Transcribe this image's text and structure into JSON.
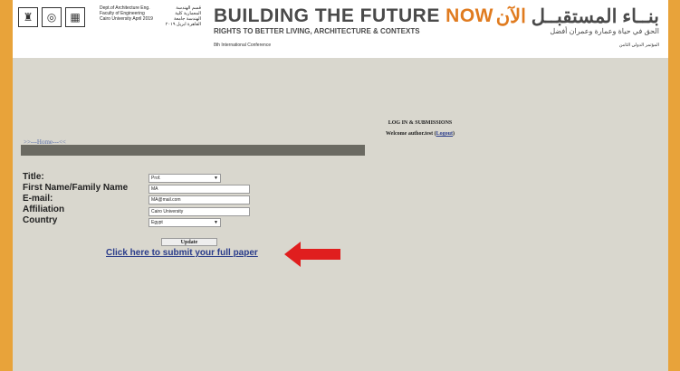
{
  "banner": {
    "dept_en": "Dept.of Architecture Eng. Faculty of Engineering Cairo University April 2019",
    "dept_ar": "قسم الهندسة المعمارية كلية الهندسة جامعة القاهرة ابريل ٢٠١٩",
    "title_main": "BUILDING THE FUTURE ",
    "title_now": "NOW",
    "subtitle": "RIGHTS TO BETTER LIVING, ARCHITECTURE & CONTEXTS",
    "conference_en": "8th International Conference",
    "title_ar_main": "بنــاء المستقبــل ",
    "title_ar_now": "الآن",
    "subtitle_ar": "الحق في حياة وعمارة وعمران أفضل",
    "conference_ar": "المؤتمر الدولي الثامن"
  },
  "nav": {
    "home_link": ">>---Home---<<"
  },
  "login": {
    "header": "LOG IN & SUBMISSIONS",
    "welcome": "Welcome author.test",
    "logout_open": "(",
    "logout_label": "Logout",
    "logout_close": ")"
  },
  "form": {
    "title_label": "Title:",
    "title_value": "Prof.",
    "name_label": "First Name/Family Name",
    "name_value": "MA",
    "email_label": "E-mail:",
    "email_value": "MA@mail.com",
    "affiliation_label": "Affiliation",
    "affiliation_value": "Cairo University",
    "country_label": "Country",
    "country_value": "Egypt",
    "update_label": "Update",
    "submit_link": "Click here to submit your full paper"
  },
  "colors": {
    "accent_orange": "#e07b1f",
    "page_bg": "#d9d7ce",
    "outer_bg": "#e8a33a",
    "arrow_red": "#e01e1e"
  }
}
